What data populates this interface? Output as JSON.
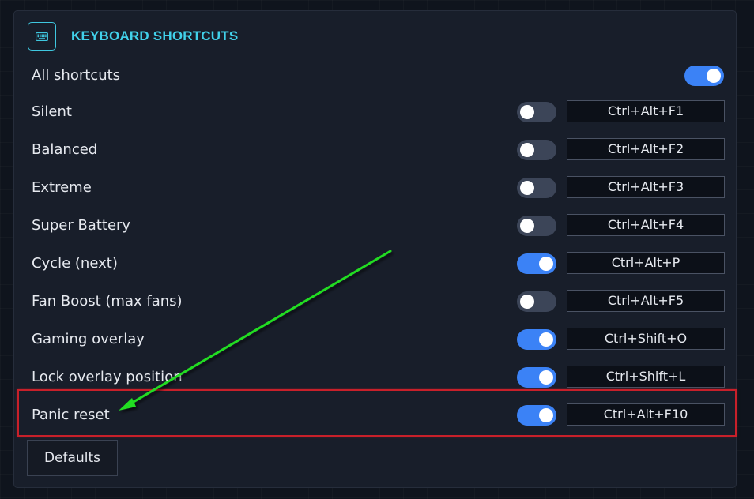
{
  "header": {
    "title": "KEYBOARD SHORTCUTS",
    "icon": "keyboard-icon"
  },
  "colors": {
    "accent": "#41d1ea",
    "toggle_on": "#3b82f6",
    "toggle_off": "#3c4558",
    "highlight": "#c8202a",
    "arrow": "#22dd22"
  },
  "master": {
    "label": "All shortcuts",
    "enabled": true
  },
  "shortcuts": [
    {
      "label": "Silent",
      "enabled": false,
      "keys": "Ctrl+Alt+F1"
    },
    {
      "label": "Balanced",
      "enabled": false,
      "keys": "Ctrl+Alt+F2"
    },
    {
      "label": "Extreme",
      "enabled": false,
      "keys": "Ctrl+Alt+F3"
    },
    {
      "label": "Super Battery",
      "enabled": false,
      "keys": "Ctrl+Alt+F4"
    },
    {
      "label": "Cycle (next)",
      "enabled": true,
      "keys": "Ctrl+Alt+P"
    },
    {
      "label": "Fan Boost (max fans)",
      "enabled": false,
      "keys": "Ctrl+Alt+F5"
    },
    {
      "label": "Gaming overlay",
      "enabled": true,
      "keys": "Ctrl+Shift+O"
    },
    {
      "label": "Lock overlay position",
      "enabled": true,
      "keys": "Ctrl+Shift+L"
    },
    {
      "label": "Panic reset",
      "enabled": true,
      "keys": "Ctrl+Alt+F10"
    }
  ],
  "defaults_label": "Defaults"
}
